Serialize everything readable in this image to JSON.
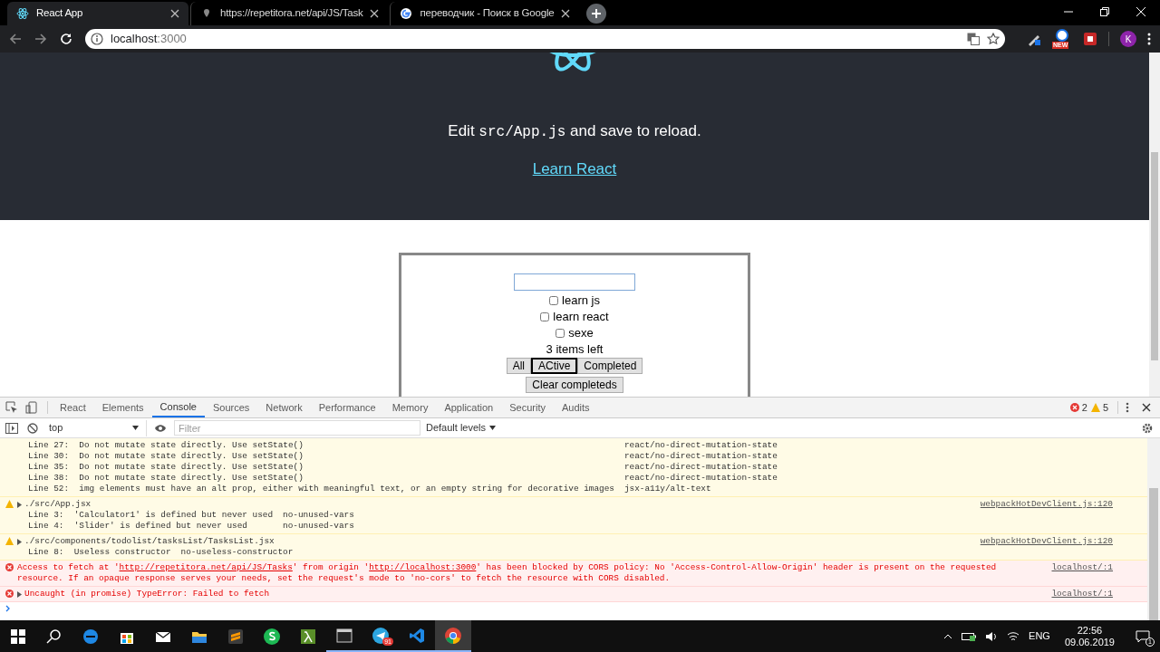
{
  "browser": {
    "tabs": [
      {
        "title": "React App",
        "selected": true
      },
      {
        "title": "https://repetitora.net/api/JS/Task",
        "selected": false
      },
      {
        "title": "переводчик - Поиск в Google",
        "selected": false
      }
    ],
    "address": {
      "host": "localhost",
      "port": ":3000"
    },
    "extension_badge": "NEW",
    "profile": "K"
  },
  "page": {
    "edit_prefix": "Edit ",
    "edit_code": "src/App.js",
    "edit_suffix": " and save to reload.",
    "link": "Learn React",
    "todo": {
      "items": [
        {
          "label": "learn js",
          "checked": false
        },
        {
          "label": "learn react",
          "checked": false
        },
        {
          "label": "sexe",
          "checked": false
        }
      ],
      "count": "3 items left",
      "filters": [
        {
          "label": "All",
          "selected": false
        },
        {
          "label": "ACtive",
          "selected": true
        },
        {
          "label": "Completed",
          "selected": false
        }
      ],
      "clear": "Clear completeds"
    }
  },
  "devtools": {
    "tabs": [
      {
        "label": "React",
        "selected": false
      },
      {
        "label": "Elements",
        "selected": false
      },
      {
        "label": "Console",
        "selected": true
      },
      {
        "label": "Sources",
        "selected": false
      },
      {
        "label": "Network",
        "selected": false
      },
      {
        "label": "Performance",
        "selected": false
      },
      {
        "label": "Memory",
        "selected": false
      },
      {
        "label": "Application",
        "selected": false
      },
      {
        "label": "Security",
        "selected": false
      },
      {
        "label": "Audits",
        "selected": false
      }
    ],
    "error_count": "2",
    "warning_count": "5",
    "context": "top",
    "filter_placeholder": "Filter",
    "levels": "Default levels",
    "messages": [
      {
        "kind": "warning",
        "lines": [
          {
            "text": "Line 27:  Do not mutate state directly. Use setState()",
            "rule": "react/no-direct-mutation-state"
          },
          {
            "text": "Line 30:  Do not mutate state directly. Use setState()",
            "rule": "react/no-direct-mutation-state"
          },
          {
            "text": "Line 35:  Do not mutate state directly. Use setState()",
            "rule": "react/no-direct-mutation-state"
          },
          {
            "text": "Line 38:  Do not mutate state directly. Use setState()",
            "rule": "react/no-direct-mutation-state"
          },
          {
            "text": "Line 52:  img elements must have an alt prop, either with meaningful text, or an empty string for decorative images",
            "rule": "jsx-a11y/alt-text"
          }
        ]
      },
      {
        "kind": "warning",
        "header": "./src/App.jsx",
        "source": "webpackHotDevClient.js:120",
        "lines": [
          {
            "text": "Line 3:  'Calculator1' is defined but never used",
            "rule": "no-unused-vars"
          },
          {
            "text": "Line 4:  'Slider' is defined but never used",
            "rule": "no-unused-vars"
          }
        ]
      },
      {
        "kind": "warning",
        "header": "./src/components/todolist/tasksList/TasksList.jsx",
        "source": "webpackHotDevClient.js:120",
        "lines": [
          {
            "text": "Line 8:  Useless constructor",
            "rule": "no-useless-constructor"
          }
        ]
      },
      {
        "kind": "error",
        "parts": [
          {
            "text": "Access to fetch at '"
          },
          {
            "link": "http://repetitora.net/api/JS/Tasks"
          },
          {
            "text": "' from origin '"
          },
          {
            "link": "http://localhost:3000"
          },
          {
            "text": "' has been blocked by CORS policy: No 'Access-Control-Allow-Origin' header is present on the requested resource. If an opaque response serves your needs, set the request's mode to 'no-cors' to fetch the resource with CORS disabled."
          }
        ],
        "source": "localhost/:1"
      },
      {
        "kind": "error",
        "header": "Uncaught (in promise) TypeError: Failed to fetch",
        "source": "localhost/:1"
      }
    ]
  },
  "taskbar": {
    "telegram_badge": "91",
    "language": "ENG",
    "time": "22:56",
    "date": "09.06.2019",
    "notifications": "1"
  }
}
